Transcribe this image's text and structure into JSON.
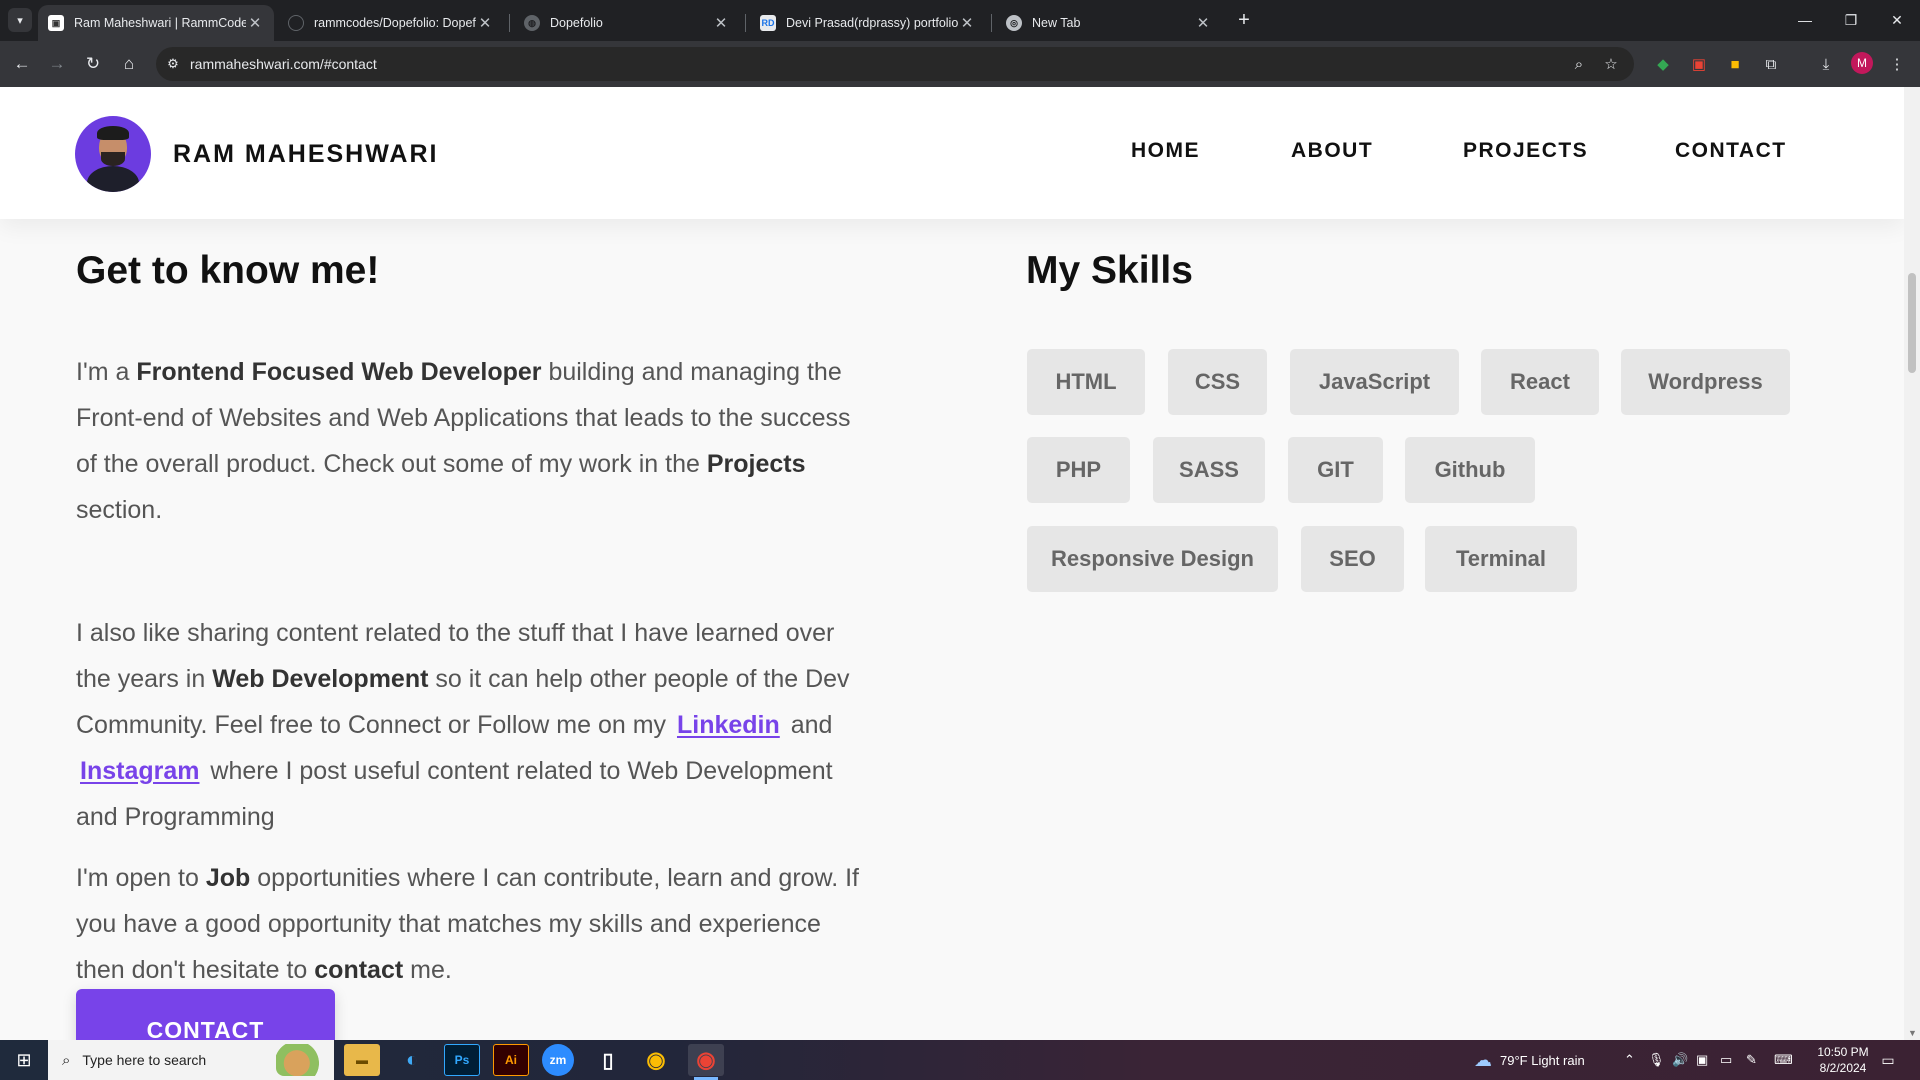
{
  "browser": {
    "tabs": [
      {
        "title": "Ram Maheshwari | RammCodes",
        "active": true
      },
      {
        "title": "rammcodes/Dopefolio: Dopefolio",
        "active": false
      },
      {
        "title": "Dopefolio",
        "active": false
      },
      {
        "title": "Devi Prasad(rdprassy) portfolio",
        "active": false
      },
      {
        "title": "New Tab",
        "active": false
      }
    ],
    "url": "rammaheshwari.com/#contact",
    "profile_initial": "M"
  },
  "site": {
    "brand": "RAM MAHESHWARI",
    "nav": [
      "HOME",
      "ABOUT",
      "PROJECTS",
      "CONTACT"
    ]
  },
  "about": {
    "heading": "Get to know me!",
    "p1": {
      "a": "I'm a ",
      "b": "Frontend Focused Web Developer",
      "c": " building and managing the Front-end of Websites and Web Applications that leads to the success of the overall product. Check out some of my work in the ",
      "d": "Projects",
      "e": " section."
    },
    "p2": {
      "a": "I also like sharing content related to the stuff that I have learned over the years in ",
      "b": "Web Development",
      "c": " so it can help other people of the Dev Community. Feel free to Connect or Follow me on my ",
      "link1": "Linkedin",
      "d": " and ",
      "link2": "Instagram",
      "e": " where I post useful content related to Web Development and Programming"
    },
    "p3": {
      "a": "I'm open to ",
      "b": "Job",
      "c": " opportunities where I can contribute, learn and grow. If you have a good opportunity that matches my skills and experience then don't hesitate to ",
      "d": "contact",
      "e": " me."
    },
    "cta_label": "CONTACT"
  },
  "skills": {
    "heading": "My Skills",
    "items": [
      "HTML",
      "CSS",
      "JavaScript",
      "React",
      "Wordpress",
      "PHP",
      "SASS",
      "GIT",
      "Github",
      "Responsive Design",
      "SEO",
      "Terminal"
    ]
  },
  "taskbar": {
    "search_placeholder": "Type here to search",
    "weather": "79°F  Light rain",
    "time": "10:50 PM",
    "date": "8/2/2024"
  },
  "colors": {
    "accent": "#7843e9",
    "chip_bg": "#e6e6e6",
    "page_bg": "#f9f9f9"
  }
}
